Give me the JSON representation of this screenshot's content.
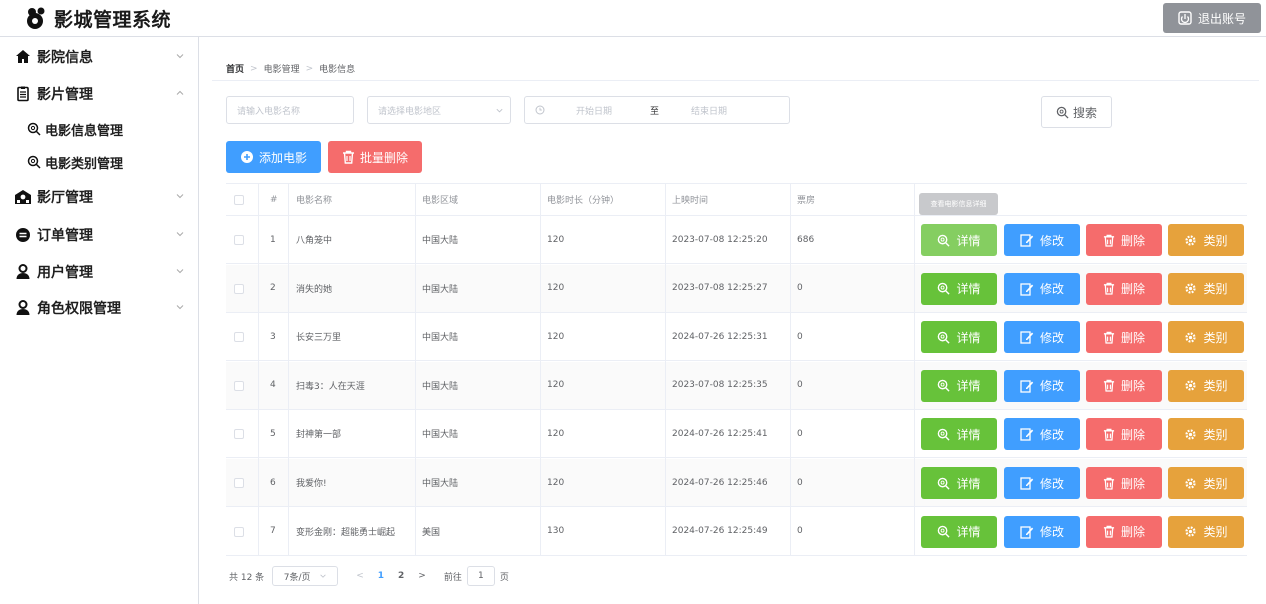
{
  "header": {
    "app_title": "影城管理系统",
    "logout_label": "退出账号"
  },
  "sidebar": {
    "items": [
      {
        "label": "影院信息",
        "icon": "home-icon"
      },
      {
        "label": "影片管理",
        "icon": "clipboard-icon",
        "expanded": true
      },
      {
        "label": "电影信息管理",
        "icon": "search-icon"
      },
      {
        "label": "电影类别管理",
        "icon": "search-icon"
      },
      {
        "label": "影厅管理",
        "icon": "theater-icon"
      },
      {
        "label": "订单管理",
        "icon": "order-icon"
      },
      {
        "label": "用户管理",
        "icon": "user-icon"
      },
      {
        "label": "角色权限管理",
        "icon": "user-icon"
      }
    ]
  },
  "breadcrumb": [
    "首页",
    "电影管理",
    "电影信息"
  ],
  "filters": {
    "name_placeholder": "请输入电影名称",
    "region_placeholder": "请选择电影地区",
    "start_placeholder": "开始日期",
    "range_sep": "至",
    "end_placeholder": "结束日期",
    "search_label": "搜索"
  },
  "toolbar": {
    "add_label": "添加电影",
    "batch_delete_label": "批量删除"
  },
  "table": {
    "columns": [
      "#",
      "电影名称",
      "电影区域",
      "电影时长（分钟）",
      "上映时间",
      "票房",
      "操作"
    ],
    "rows": [
      {
        "index": "1",
        "name": "八角笼中",
        "region": "中国大陆",
        "duration": "120",
        "release": "2023-07-08 12:25:20",
        "box": "686"
      },
      {
        "index": "2",
        "name": "消失的她",
        "region": "中国大陆",
        "duration": "120",
        "release": "2023-07-08 12:25:27",
        "box": "0"
      },
      {
        "index": "3",
        "name": "长安三万里",
        "region": "中国大陆",
        "duration": "120",
        "release": "2024-07-26 12:25:31",
        "box": "0"
      },
      {
        "index": "4",
        "name": "扫毒3：人在天涯",
        "region": "中国大陆",
        "duration": "120",
        "release": "2023-07-08 12:25:35",
        "box": "0"
      },
      {
        "index": "5",
        "name": "封神第一部",
        "region": "中国大陆",
        "duration": "120",
        "release": "2024-07-26 12:25:41",
        "box": "0"
      },
      {
        "index": "6",
        "name": "我爱你!",
        "region": "中国大陆",
        "duration": "120",
        "release": "2024-07-26 12:25:46",
        "box": "0"
      },
      {
        "index": "7",
        "name": "变形金刚：超能勇士崛起",
        "region": "美国",
        "duration": "130",
        "release": "2024-07-26 12:25:49",
        "box": "0"
      }
    ],
    "actions": {
      "detail": "详情",
      "edit": "修改",
      "delete": "删除",
      "category": "类别"
    },
    "tooltip": "查看电影信息详细"
  },
  "pagination": {
    "total": "共 12 条",
    "page_size": "7条/页",
    "pages": [
      "1",
      "2"
    ],
    "goto_prefix": "前往",
    "goto_value": "1",
    "goto_suffix": "页"
  },
  "colors": {
    "primary": "#409eff",
    "success": "#67c23a",
    "danger": "#f56c6c",
    "warning": "#e6a23c",
    "logout_bg": "#909399"
  }
}
